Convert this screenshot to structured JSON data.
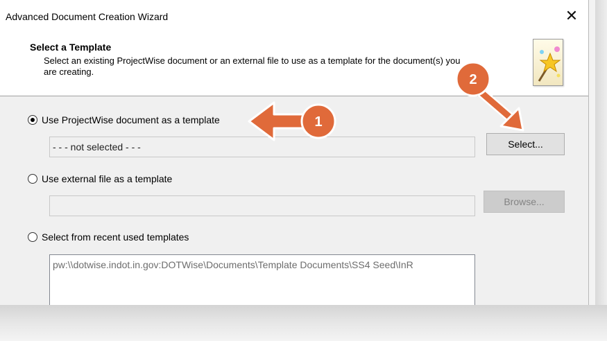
{
  "window": {
    "title": "Advanced Document Creation Wizard",
    "close_glyph": "✕"
  },
  "header": {
    "title": "Select a Template",
    "description": "Select an existing ProjectWise document or an external file to use as a template for the document(s) you are creating.",
    "icon": "wizard-wand-icon"
  },
  "options": {
    "pw_document": {
      "label": "Use ProjectWise document as a template",
      "checked": true,
      "value": "- - - not selected - - -",
      "button": "Select..."
    },
    "external_file": {
      "label": "Use external file as a template",
      "checked": false,
      "value": "",
      "button": "Browse..."
    },
    "recent": {
      "label": "Select from recent used templates",
      "checked": false,
      "items": [
        "pw:\\\\dotwise.indot.in.gov:DOTWise\\Documents\\Template Documents\\SS4 Seed\\InR"
      ]
    }
  },
  "callouts": [
    {
      "number": "1",
      "color": "#e06a3a"
    },
    {
      "number": "2",
      "color": "#e06a3a"
    }
  ]
}
